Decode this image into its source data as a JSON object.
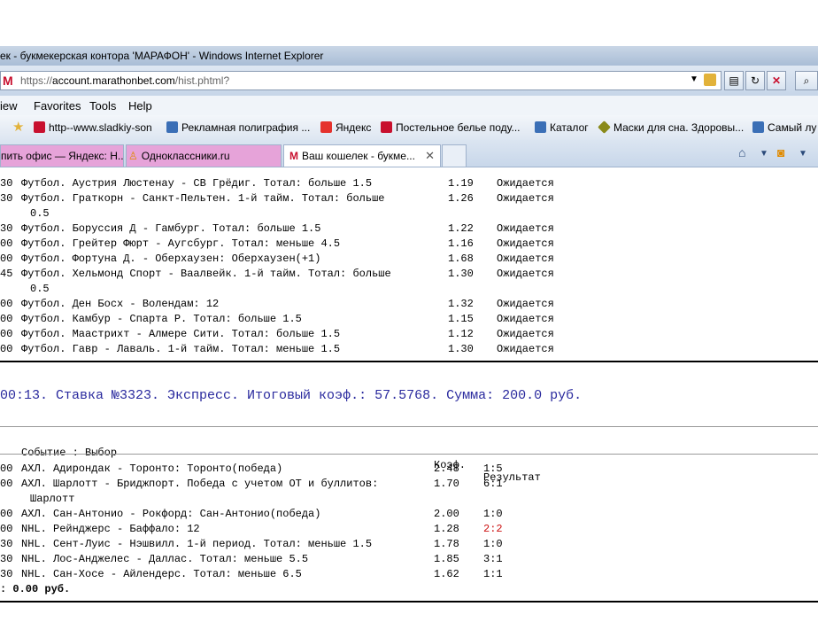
{
  "window": {
    "title": "ек - букмекерская контора 'МАРАФОН' - Windows Internet Explorer"
  },
  "address": {
    "url_prefix": "https://",
    "url_domain": "account.marathonbet.com",
    "url_path": "/hist.phtml?"
  },
  "menu": {
    "items": [
      "iew",
      "Favorites",
      "Tools",
      "Help"
    ]
  },
  "favorites": [
    {
      "label": "http--www.sladkiy-son",
      "icon": "red-square-icon",
      "color": "#c8102e"
    },
    {
      "label": "Рекламная полиграфия ...",
      "icon": "ie-page-icon",
      "color": "#3b6fb6"
    },
    {
      "label": "Яндекс",
      "icon": "yandex-icon",
      "color": "#e5322d"
    },
    {
      "label": "Постельное белье поду...",
      "icon": "red-square-icon",
      "color": "#c8102e"
    },
    {
      "label": "Каталог",
      "icon": "ie-page-icon",
      "color": "#3b6fb6"
    },
    {
      "label": "Маски для сна. Здоровы...",
      "icon": "diamond-icon",
      "color": "#8a8a1a"
    },
    {
      "label": "Самый лу",
      "icon": "ie-page-icon",
      "color": "#3b6fb6"
    }
  ],
  "tabs": [
    {
      "label": "пить офис — Яндекс: Н..."
    },
    {
      "label": "Одноклассники.ru"
    },
    {
      "label": "Ваш кошелек - букме..."
    }
  ],
  "bet1": {
    "rows": [
      {
        "time": "30",
        "event": "Футбол. Аустрия Люстенау - СВ Грёдиг. Тотал: больше 1.5",
        "cont": "",
        "coef": "1.19",
        "result": "Ожидается"
      },
      {
        "time": "30",
        "event": "Футбол. Граткорн - Санкт-Пельтен. 1-й тайм. Тотал: больше",
        "cont": "0.5",
        "coef": "1.26",
        "result": "Ожидается"
      },
      {
        "time": "30",
        "event": "Футбол. Боруссия Д - Гамбург. Тотал: больше 1.5",
        "cont": "",
        "coef": "1.22",
        "result": "Ожидается"
      },
      {
        "time": "00",
        "event": "Футбол. Грейтер Фюрт - Аугсбург. Тотал: меньше 4.5",
        "cont": "",
        "coef": "1.16",
        "result": "Ожидается"
      },
      {
        "time": "00",
        "event": "Футбол. Фортуна Д. - Оберхаузен: Оберхаузен(+1)",
        "cont": "",
        "coef": "1.68",
        "result": "Ожидается"
      },
      {
        "time": "45",
        "event": "Футбол. Хельмонд Спорт - Ваалвейк. 1-й тайм. Тотал: больше",
        "cont": "0.5",
        "coef": "1.30",
        "result": "Ожидается"
      },
      {
        "time": "00",
        "event": "Футбол. Ден Босх - Волендам: 12",
        "cont": "",
        "coef": "1.32",
        "result": "Ожидается"
      },
      {
        "time": "00",
        "event": "Футбол. Камбур - Спарта Р. Тотал: больше 1.5",
        "cont": "",
        "coef": "1.15",
        "result": "Ожидается"
      },
      {
        "time": "00",
        "event": "Футбол. Маастрихт - Алмере Сити. Тотал: больше 1.5",
        "cont": "",
        "coef": "1.12",
        "result": "Ожидается"
      },
      {
        "time": "00",
        "event": "Футбол. Гавр - Лаваль. 1-й тайм. Тотал: меньше 1.5",
        "cont": "",
        "coef": "1.30",
        "result": "Ожидается"
      }
    ]
  },
  "bet2": {
    "heading": "00:13. Ставка №3323. Экспресс. Итоговый коэф.: 57.5768. Сумма: 200.0 руб.",
    "col_event": "Событие : Выбор",
    "col_coef": "Коэф.",
    "col_result": "Результат",
    "rows": [
      {
        "time": "00",
        "event": "АХЛ. Адирондак - Торонто: Торонто(победа)",
        "cont": "",
        "coef": "2.48",
        "result": "1:5",
        "lost": false
      },
      {
        "time": "00",
        "event": "АХЛ. Шарлотт - Бриджпорт. Победа с учетом ОТ и буллитов:",
        "cont": "Шарлотт",
        "coef": "1.70",
        "result": "6:1",
        "lost": false
      },
      {
        "time": "00",
        "event": "АХЛ. Сан-Антонио - Рокфорд: Сан-Антонио(победа)",
        "cont": "",
        "coef": "2.00",
        "result": "1:0",
        "lost": false
      },
      {
        "time": "00",
        "event": "NHL. Рейнджерс - Баффало: 12",
        "cont": "",
        "coef": "1.28",
        "result": "2:2",
        "lost": true
      },
      {
        "time": "30",
        "event": "NHL. Сент-Луис - Нэшвилл. 1-й период. Тотал: меньше 1.5",
        "cont": "",
        "coef": "1.78",
        "result": "1:0",
        "lost": false
      },
      {
        "time": "30",
        "event": "NHL. Лос-Анджелес - Даллас. Тотал: меньше 5.5",
        "cont": "",
        "coef": "1.85",
        "result": "3:1",
        "lost": false
      },
      {
        "time": "30",
        "event": "NHL. Сан-Хосе - Айлендерс. Тотал: меньше 6.5",
        "cont": "",
        "coef": "1.62",
        "result": "1:1",
        "lost": false
      }
    ],
    "payout": ": 0.00 руб."
  }
}
